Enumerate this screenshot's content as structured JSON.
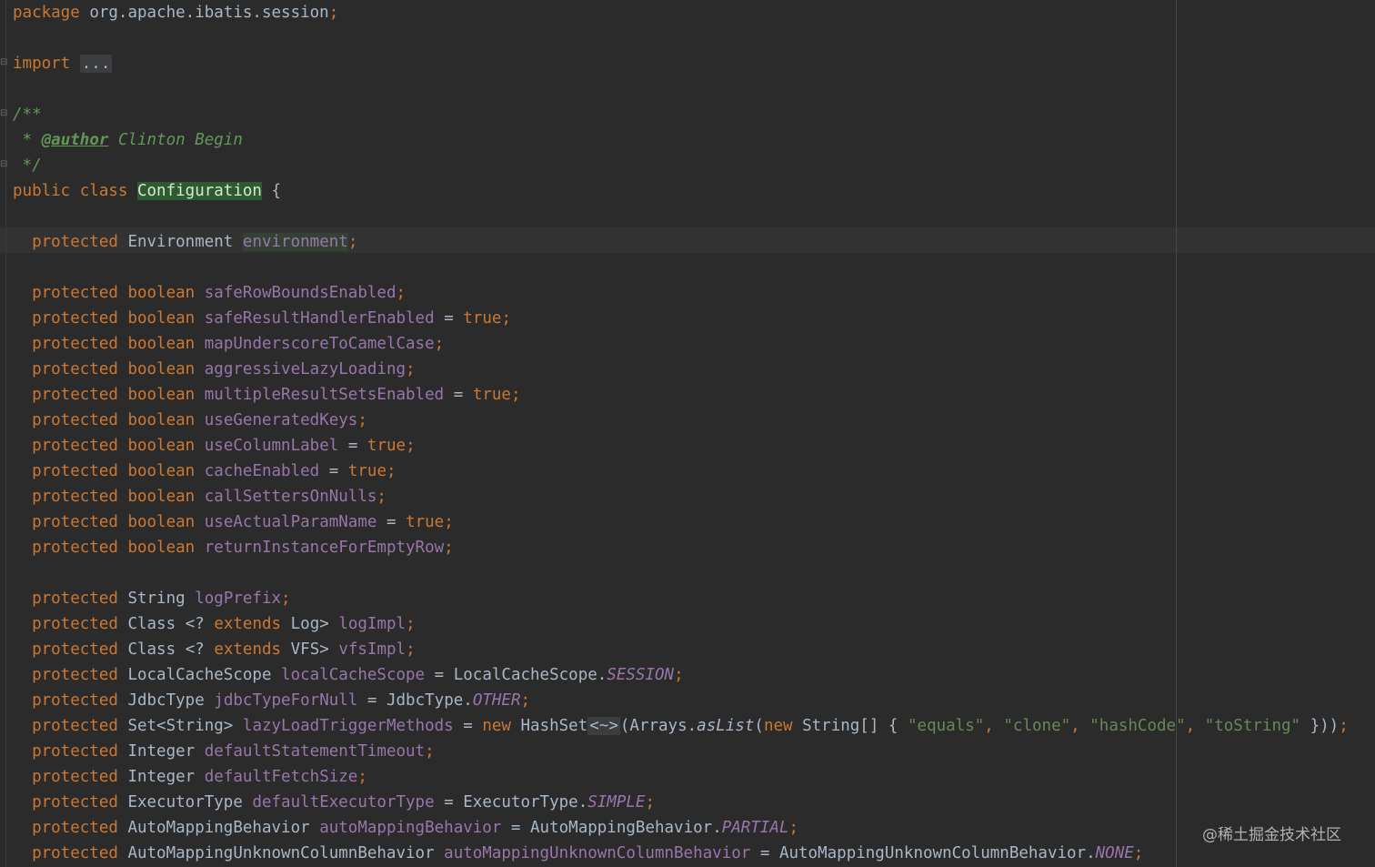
{
  "editor": {
    "package_line": {
      "kw": "package",
      "name": "org.apache.ibatis.session",
      "semi": ";"
    },
    "import_line": {
      "kw": "import",
      "folded": "..."
    },
    "javadoc": {
      "open": "/**",
      "star": "*",
      "author_tag": "@author",
      "author_name": "Clinton Begin",
      "close": "*/"
    },
    "class_decl": {
      "modifiers": "public class",
      "name": "Configuration",
      "brace": "{"
    },
    "environment_field": {
      "mod": "protected",
      "type": "Environment",
      "name": "environment",
      "semi": ";"
    },
    "boolean_fields": [
      {
        "name": "safeRowBoundsEnabled",
        "init": ""
      },
      {
        "name": "safeResultHandlerEnabled",
        "init": "true"
      },
      {
        "name": "mapUnderscoreToCamelCase",
        "init": ""
      },
      {
        "name": "aggressiveLazyLoading",
        "init": ""
      },
      {
        "name": "multipleResultSetsEnabled",
        "init": "true"
      },
      {
        "name": "useGeneratedKeys",
        "init": ""
      },
      {
        "name": "useColumnLabel",
        "init": "true"
      },
      {
        "name": "cacheEnabled",
        "init": "true"
      },
      {
        "name": "callSettersOnNulls",
        "init": ""
      },
      {
        "name": "useActualParamName",
        "init": "true"
      },
      {
        "name": "returnInstanceForEmptyRow",
        "init": ""
      }
    ],
    "log_prefix": {
      "type": "String",
      "name": "logPrefix"
    },
    "log_impl": {
      "type": "Class",
      "generic_open": "<?",
      "extends_kw": "extends",
      "bound": "Log>",
      "name": "logImpl"
    },
    "vfs_impl": {
      "type": "Class",
      "generic_open": "<?",
      "extends_kw": "extends",
      "bound": "VFS>",
      "name": "vfsImpl"
    },
    "local_cache_scope": {
      "type": "LocalCacheScope",
      "name": "localCacheScope",
      "eq": "=",
      "owner": "LocalCacheScope.",
      "constant": "SESSION"
    },
    "jdbc_type": {
      "type": "JdbcType",
      "name": "jdbcTypeForNull",
      "eq": "=",
      "owner": "JdbcType.",
      "constant": "OTHER"
    },
    "lazy_load": {
      "type": "Set<String>",
      "name": "lazyLoadTriggerMethods",
      "eq": "=",
      "new_kw": "new",
      "hashset": "HashSet",
      "diamond": "<~>",
      "paren": "(Arrays.",
      "aslist": "asList",
      "paren2": "(",
      "new_kw2": "new",
      "array_type": "String[] {",
      "s1": "\"equals\"",
      "s2": "\"clone\"",
      "s3": "\"hashCode\"",
      "s4": "\"toString\"",
      "close": " }))",
      "comma": ","
    },
    "default_statement_timeout": {
      "type": "Integer",
      "name": "defaultStatementTimeout"
    },
    "default_fetch_size": {
      "type": "Integer",
      "name": "defaultFetchSize"
    },
    "default_executor_type": {
      "type": "ExecutorType",
      "name": "defaultExecutorType",
      "eq": "=",
      "owner": "ExecutorType.",
      "constant": "SIMPLE"
    },
    "auto_mapping_behavior": {
      "type": "AutoMappingBehavior",
      "name": "autoMappingBehavior",
      "eq": "=",
      "owner": "AutoMappingBehavior.",
      "constant": "PARTIAL"
    },
    "auto_mapping_unknown": {
      "type": "AutoMappingUnknownColumnBehavior",
      "name": "autoMappingUnknownColumnBehavior",
      "eq": "=",
      "owner": "AutoMappingUnknownColumnBehavior.",
      "constant": "NONE"
    },
    "protected_kw": "protected",
    "boolean_kw": "boolean",
    "true_kw": "true",
    "eq": "=",
    "semi": ";",
    "space": " "
  },
  "watermark": "@稀土掘金技术社区",
  "colors": {
    "background": "#2b2b2b",
    "keyword": "#cc7832",
    "field": "#9876aa",
    "string": "#6a8759",
    "doc_comment": "#629755",
    "plain": "#a9b7c6"
  }
}
